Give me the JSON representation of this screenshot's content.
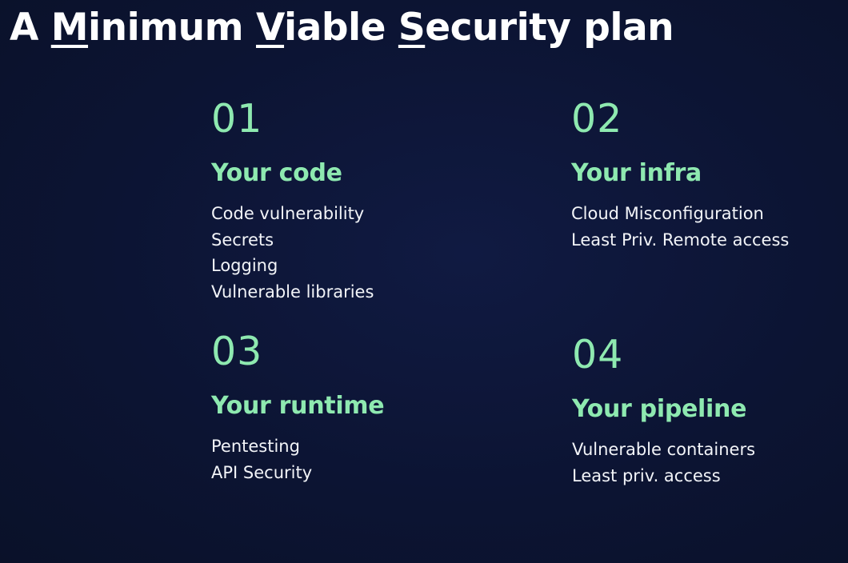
{
  "title": {
    "parts": [
      {
        "text": "A ",
        "underline": false
      },
      {
        "text": "M",
        "underline": true
      },
      {
        "text": "inimum ",
        "underline": false
      },
      {
        "text": "V",
        "underline": true
      },
      {
        "text": "iable ",
        "underline": false
      },
      {
        "text": "S",
        "underline": true
      },
      {
        "text": "ecurity plan",
        "underline": false
      }
    ]
  },
  "accent_color": "#8ee9b0",
  "background_color": "#0c1433",
  "sections": [
    {
      "number": "01",
      "heading": "Your code",
      "items": [
        "Code vulnerability",
        "Secrets",
        "Logging",
        "Vulnerable libraries"
      ]
    },
    {
      "number": "02",
      "heading": "Your infra",
      "items": [
        "Cloud Misconfiguration",
        "Least Priv. Remote access"
      ]
    },
    {
      "number": "03",
      "heading": "Your runtime",
      "items": [
        "Pentesting",
        "API Security"
      ]
    },
    {
      "number": "04",
      "heading": "Your pipeline",
      "items": [
        "Vulnerable containers",
        "Least priv. access"
      ]
    }
  ]
}
